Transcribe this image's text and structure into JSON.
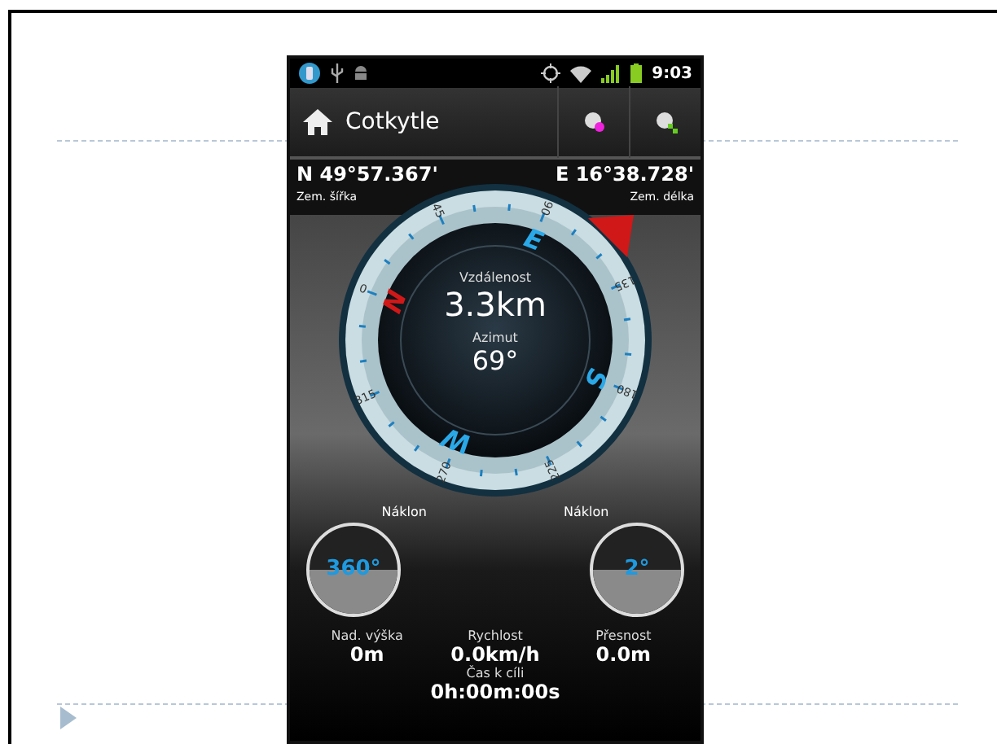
{
  "status_bar": {
    "time": "9:03"
  },
  "action_bar": {
    "title": "Cotkytle"
  },
  "coordinates": {
    "latitude": "N 49°57.367'",
    "latitude_label": "Zem. šířka",
    "longitude": "E 16°38.728'",
    "longitude_label": "Zem. délka"
  },
  "compass": {
    "dial_labels": [
      "0",
      "45",
      "90",
      "135",
      "180",
      "225",
      "270",
      "315"
    ],
    "cardinals": [
      "N",
      "E",
      "S",
      "W"
    ],
    "distance_label": "Vzdálenost",
    "distance": "3.3km",
    "azimuth_label": "Azimut",
    "azimuth": "69°"
  },
  "tilt_gauges": [
    {
      "label": "Náklon",
      "value": "360°"
    },
    {
      "label": "Náklon",
      "value": "2°"
    }
  ],
  "stats": [
    {
      "label": "Nad. výška",
      "value": "0m"
    },
    {
      "label": "Rychlost",
      "value": "0.0km/h"
    },
    {
      "label": "Přesnost",
      "value": "0.0m"
    }
  ],
  "time_to_target": {
    "label": "Čas k cíli",
    "value": "0h:00m:00s"
  }
}
